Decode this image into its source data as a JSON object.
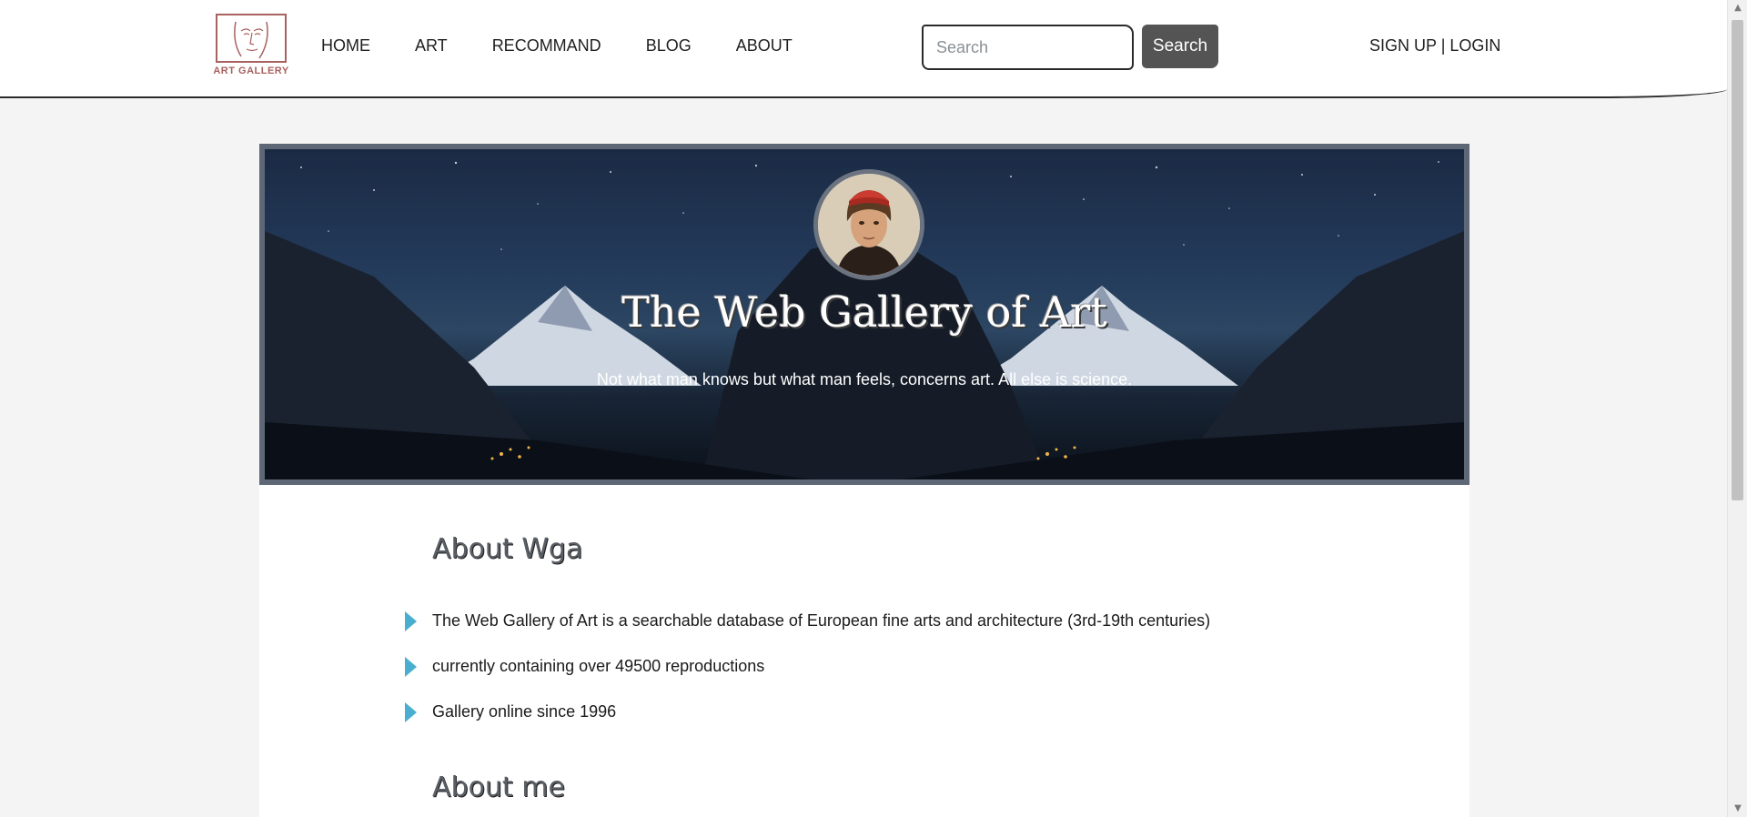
{
  "logo": {
    "text": "ART GALLERY"
  },
  "nav": {
    "items": [
      "HOME",
      "ART",
      "RECOMMAND",
      "BLOG",
      "ABOUT"
    ]
  },
  "search": {
    "placeholder": "Search",
    "button_label": "Search"
  },
  "auth": {
    "signup": "SIGN UP",
    "separator": "|",
    "login": "LOGIN"
  },
  "hero": {
    "title": "The Web Gallery of Art",
    "subtitle": "Not what man knows but what man feels, concerns art. All else is science."
  },
  "about_wga": {
    "title": "About Wga",
    "items": [
      "The Web Gallery of Art is a searchable database of European fine arts and architecture (3rd-19th centuries)",
      "currently containing over 49500 reproductions",
      "Gallery online since 1996"
    ]
  },
  "about_me": {
    "title": "About me"
  },
  "colors": {
    "bullet": "#4aaed0",
    "search_button": "#545454",
    "logo": "#a8625f"
  },
  "icons": [
    "logo-face-icon",
    "scroll-up-icon",
    "scroll-down-icon",
    "bullet-arrow-icon"
  ]
}
